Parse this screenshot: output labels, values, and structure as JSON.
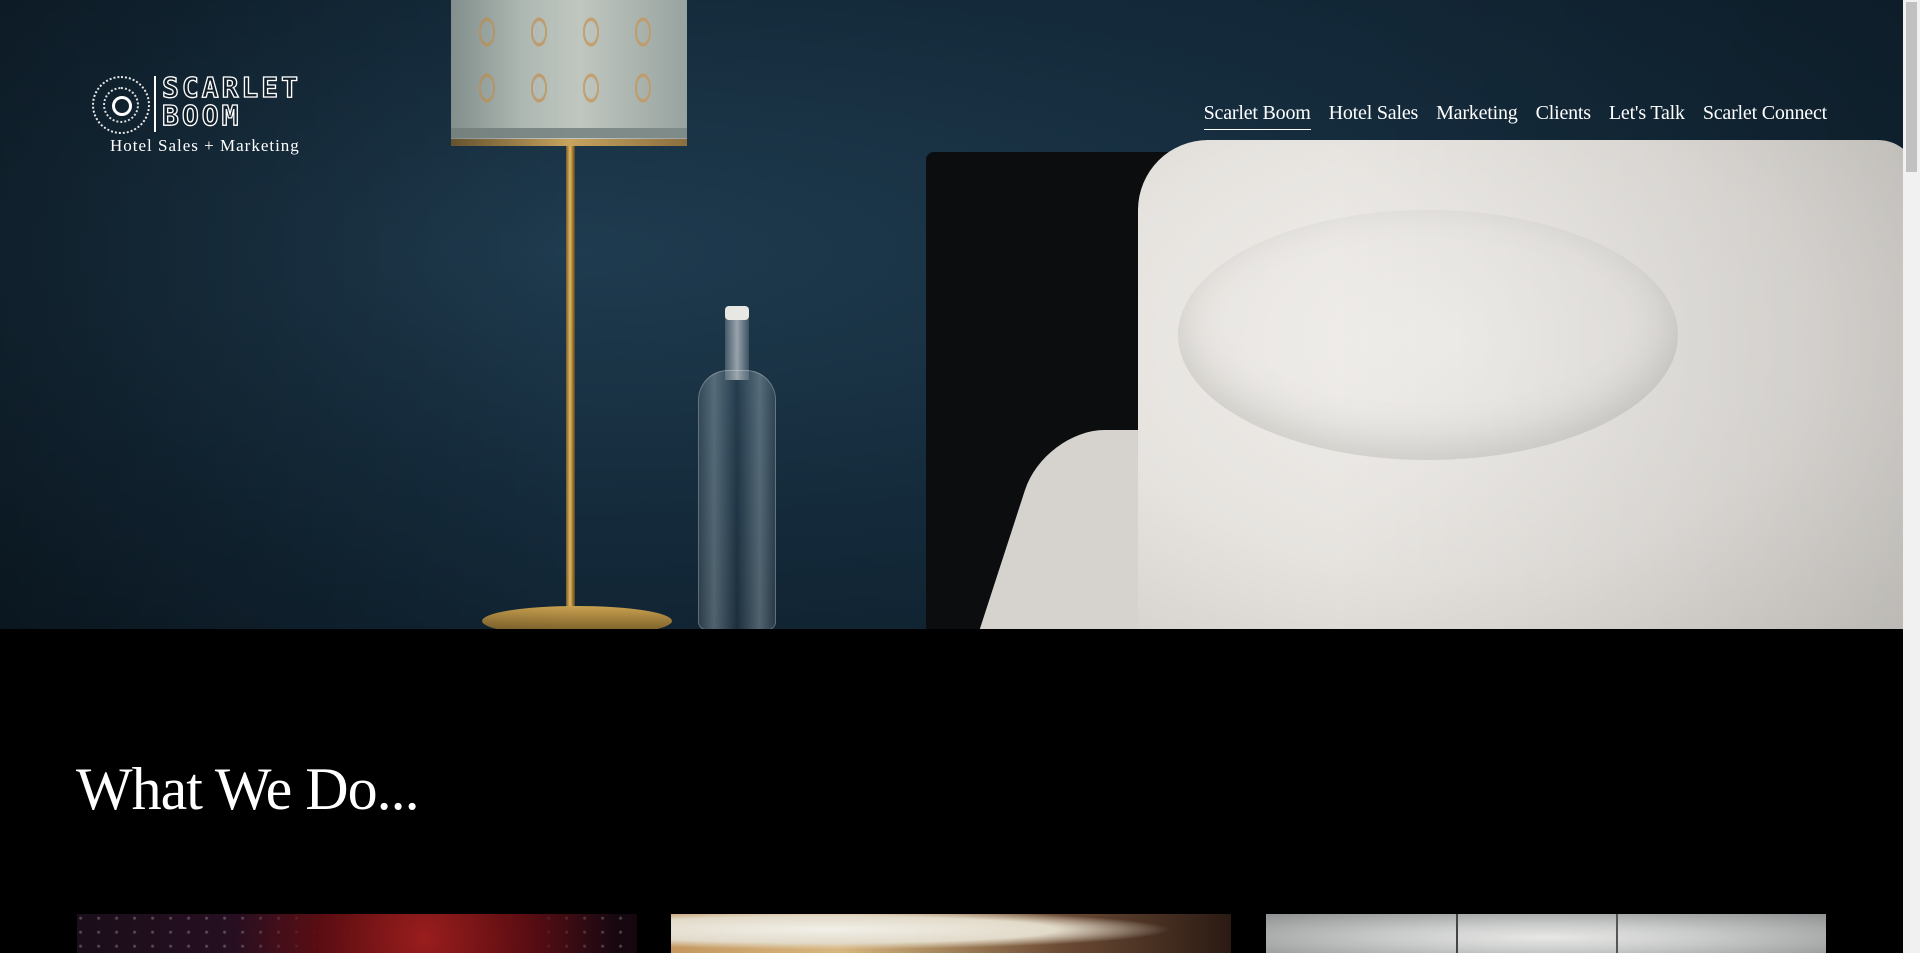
{
  "brand": {
    "name_line1": "SCARLET",
    "name_line2": "BOOM",
    "tagline": "Hotel Sales + Marketing",
    "mark_icon": "starburst-ring-icon"
  },
  "nav": {
    "items": [
      {
        "label": "Scarlet Boom",
        "active": true
      },
      {
        "label": "Hotel Sales",
        "active": false
      },
      {
        "label": "Marketing",
        "active": false
      },
      {
        "label": "Clients",
        "active": false
      },
      {
        "label": "Let's Talk",
        "active": false
      },
      {
        "label": "Scarlet Connect",
        "active": false
      }
    ]
  },
  "hero": {
    "image_subject": "bedside-lamp-bottle-pillow-photo"
  },
  "section": {
    "title": "What We Do..."
  },
  "cards": [
    {
      "image_subject": "dark-red-abstract-photo"
    },
    {
      "image_subject": "table-setting-photo"
    },
    {
      "image_subject": "sky-window-photo"
    }
  ],
  "colors": {
    "background": "#000000",
    "hero_wall": "#152c3d",
    "text": "#ffffff"
  }
}
